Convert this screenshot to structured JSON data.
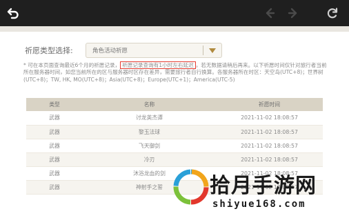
{
  "toolbar": {
    "icons": [
      "back-arrow-icon",
      "prev-arrow-icon",
      "next-arrow-icon",
      "reload-icon"
    ]
  },
  "filter": {
    "label": "祈愿类型选择:",
    "selected": "角色活动祈愿"
  },
  "notice": {
    "before": "* 可在本页面查询最近6个月的祈愿记录，",
    "highlight": "祈愿记录查询有1小时左右延迟",
    "after": "，若无数据请稍后再来。以下祈愿时间仅针对旅行者当前所在服务器时间，如您当前所在的区与服务器时区存在差异，需要旅行者自行换算。各服务器所在时区：天空岛(UTC+8)；世界树(UTC+8)；TW, HK, MO(UTC+8)；Asia(UTC+8)；Europe(UTC+1)；America(UTC-5)"
  },
  "table": {
    "headers": [
      "类型",
      "名称",
      "祈愿时间"
    ],
    "rows": [
      [
        "武器",
        "讨龙英杰谭",
        "2021-11-02 18:08:57"
      ],
      [
        "武器",
        "黎玉法球",
        "2021-11-02 18:08:57"
      ],
      [
        "武器",
        "飞天御剑",
        "2021-11-02 18:08:57"
      ],
      [
        "武器",
        "冷刃",
        "2021-11-02 18:08:57"
      ],
      [
        "武器",
        "沐浴龙血的剑",
        "2021-11-02 18:08:57"
      ],
      [
        "武器",
        "神射手之誓",
        "2021-11-02 18:08:57"
      ]
    ]
  },
  "watermark": {
    "title": "拾月手游网",
    "url": "shiyue168.com"
  },
  "colors": {
    "highlight_border": "#e53a2f",
    "table_header": "#d9d3c5",
    "select_arrow": "#b08a3e"
  }
}
